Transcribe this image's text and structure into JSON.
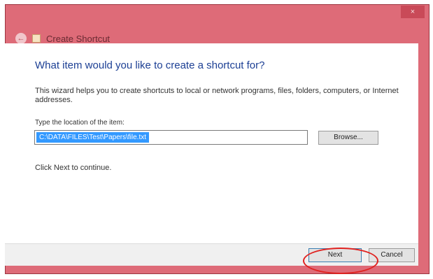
{
  "window": {
    "title": "Create Shortcut",
    "close_glyph": "×",
    "back_glyph": "←",
    "accent_color": "#de6b78"
  },
  "content": {
    "heading": "What item would you like to create a shortcut for?",
    "description": "This wizard helps you to create shortcuts to local or network programs, files, folders, computers, or Internet addresses.",
    "location_label": "Type the location of the item:",
    "location_value": "C:\\DATA\\FILES\\Test\\Papers\\file.txt",
    "browse_label": "Browse...",
    "click_next": "Click Next to continue."
  },
  "footer": {
    "next_label": "Next",
    "cancel_label": "Cancel"
  },
  "annotation": {
    "highlight_color": "#e0211f"
  }
}
